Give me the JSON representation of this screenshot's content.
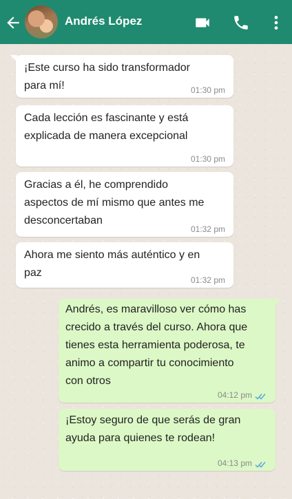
{
  "header": {
    "contact_name": "Andrés López",
    "color": "#1f8a70",
    "icons": [
      "arrow-left-icon",
      "video-camera-icon",
      "phone-icon",
      "more-vert-icon"
    ]
  },
  "messages": [
    {
      "direction": "incoming",
      "text": "¡Este curso ha sido transformador\npara mí!",
      "time": "01:30 pm"
    },
    {
      "direction": "incoming",
      "text": "Cada lección es fascinante y está\nexplicada de manera excepcional",
      "time": "01:30 pm"
    },
    {
      "direction": "incoming",
      "text": "Gracias a él, he comprendido\naspectos de mí mismo que antes me\ndesconcertaban",
      "time": "01:32 pm"
    },
    {
      "direction": "incoming",
      "text": "Ahora me siento más auténtico y en\npaz",
      "time": "01:32 pm"
    },
    {
      "direction": "outgoing",
      "text": "Andrés, es maravilloso ver cómo has\ncrecido a través del curso. Ahora que\ntienes esta herramienta poderosa, te\nanimo a compartir tu conocimiento\ncon otros",
      "time": "04:12 pm",
      "status": "read"
    },
    {
      "direction": "outgoing",
      "text": "¡Estoy seguro de que serás de gran\nayuda para quienes te rodean!",
      "time": "04:13 pm",
      "status": "read"
    }
  ],
  "colors": {
    "incoming_bubble": "#ffffff",
    "outgoing_bubble": "#dcf8c6",
    "read_ticks": "#4fa3e0",
    "chat_background": "#ece5dd"
  }
}
